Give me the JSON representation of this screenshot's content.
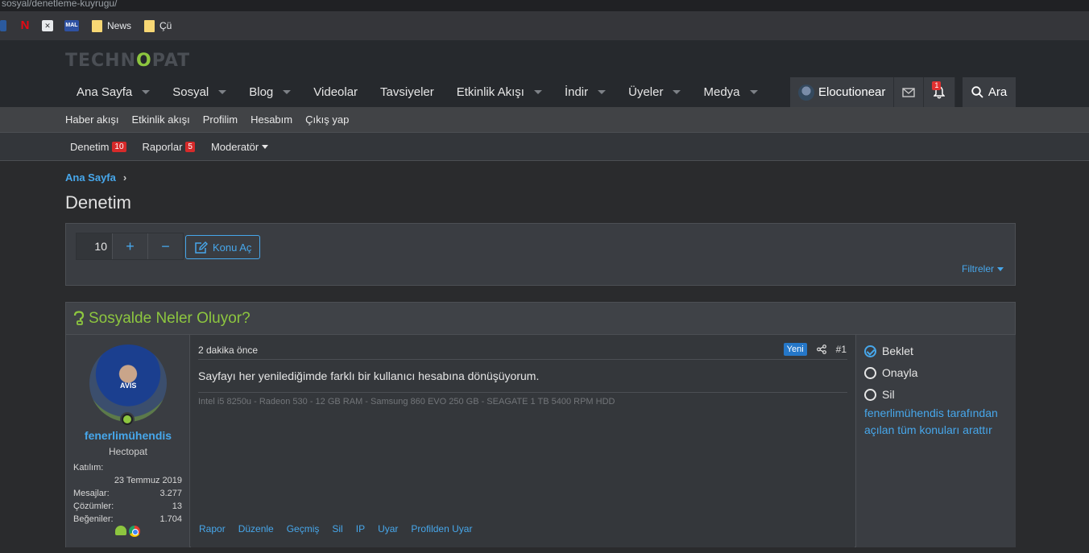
{
  "browser": {
    "url": "sosyal/denetleme-kuyrugu/",
    "bookmarks": [
      {
        "icon": "netflix-icon",
        "label": ""
      },
      {
        "icon": "app-icon",
        "label": ""
      },
      {
        "icon": "mal-icon",
        "label": "MAL"
      },
      {
        "icon": "folder-icon",
        "label": "News"
      },
      {
        "icon": "folder-icon",
        "label": "Çü"
      }
    ]
  },
  "site": {
    "logo_pre": "TECHN",
    "logo_o": "O",
    "logo_post": "PAT",
    "nav": [
      {
        "label": "Ana Sayfa",
        "caret": true
      },
      {
        "label": "Sosyal",
        "caret": true
      },
      {
        "label": "Blog",
        "caret": true
      },
      {
        "label": "Videolar",
        "caret": false
      },
      {
        "label": "Tavsiyeler",
        "caret": false
      },
      {
        "label": "Etkinlik Akışı",
        "caret": true
      },
      {
        "label": "İndir",
        "caret": true
      },
      {
        "label": "Üyeler",
        "caret": true
      },
      {
        "label": "Medya",
        "caret": true
      }
    ],
    "user": {
      "name": "Elocutionear",
      "alert_count": "1"
    },
    "search_label": "Ara",
    "subnav": [
      "Haber akışı",
      "Etkinlik akışı",
      "Profilim",
      "Hesabım",
      "Çıkış yap"
    ],
    "modbar": {
      "denetim": "Denetim",
      "denetim_count": "10",
      "raporlar": "Raporlar",
      "raporlar_count": "5",
      "moderator": "Moderatör"
    }
  },
  "page": {
    "breadcrumb": "Ana Sayfa",
    "title": "Denetim",
    "stepper_value": "10",
    "stepper_plus": "+",
    "stepper_minus": "−",
    "konu_label": "Konu Aç",
    "filters_label": "Filtreler"
  },
  "thread": {
    "title": "Sosyalde Neler Oluyor?",
    "user": {
      "name": "fenerlimühendis",
      "title": "Hectopat",
      "avatar_text": "AVIS",
      "joined_label": "Katılım:",
      "joined_value": "23 Temmuz 2019",
      "stats": [
        {
          "label": "Mesajlar:",
          "value": "3.277"
        },
        {
          "label": "Çözümler:",
          "value": "13"
        },
        {
          "label": "Beğeniler:",
          "value": "1.704"
        }
      ]
    },
    "post": {
      "date": "2 dakika önce",
      "badge": "Yeni",
      "number": "#1",
      "text": "Sayfayı her yenilediğimde farklı bir kullanıcı hesabına dönüşüyorum.",
      "signature": "Intel i5 8250u - Radeon 530 - 12 GB RAM - Samsung 860 EVO 250 GB - SEAGATE 1 TB 5400 RPM HDD",
      "actions": [
        "Rapor",
        "Düzenle",
        "Geçmiş",
        "Sil",
        "IP",
        "Uyar",
        "Profilden Uyar"
      ]
    },
    "moderation": {
      "options": [
        {
          "label": "Beklet",
          "checked": true
        },
        {
          "label": "Onayla",
          "checked": false
        },
        {
          "label": "Sil",
          "checked": false
        }
      ],
      "search_link": "fenerlimühendis tarafından açılan tüm konuları arattır"
    }
  }
}
